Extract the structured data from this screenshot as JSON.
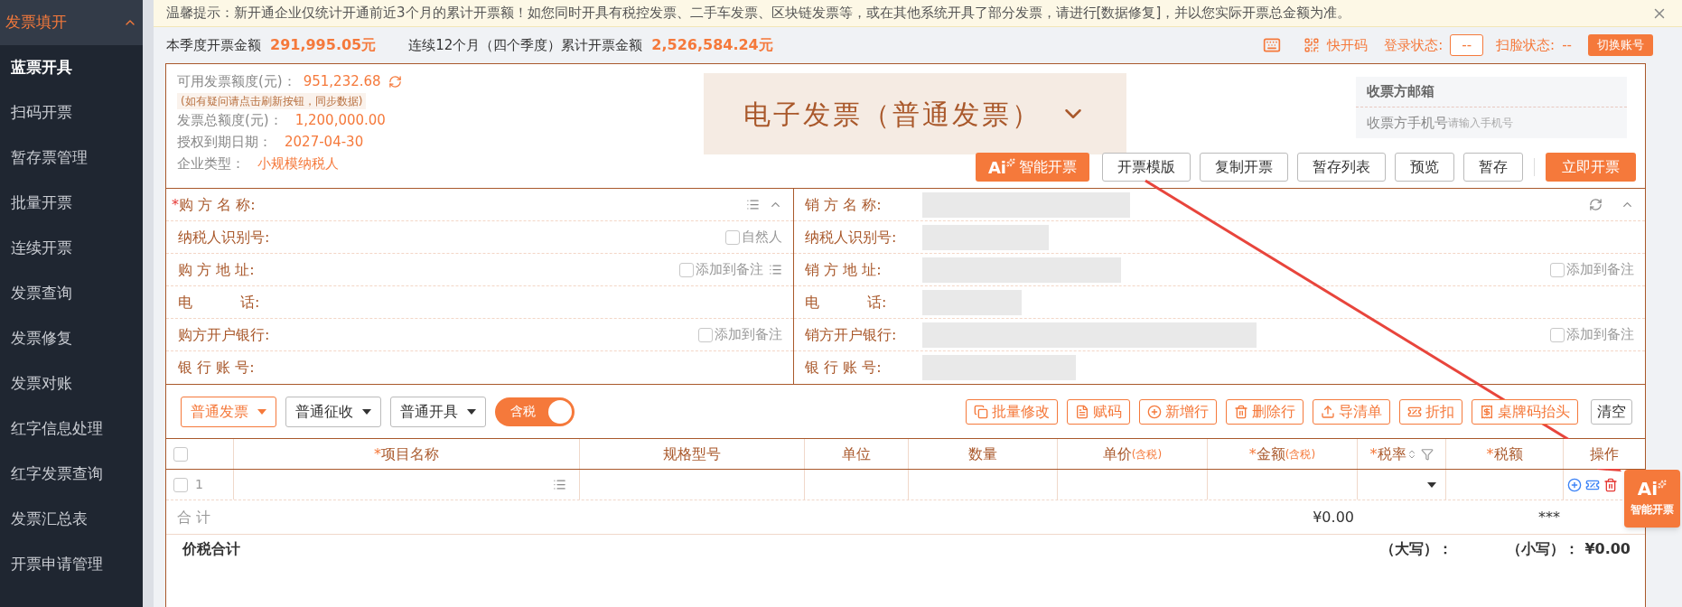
{
  "sidebar": {
    "title": "发票填开",
    "expanded": true,
    "items": [
      {
        "label": "蓝票开具",
        "selected": true
      },
      {
        "label": "扫码开票",
        "selected": false
      },
      {
        "label": "暂存票管理",
        "selected": false
      },
      {
        "label": "批量开票",
        "selected": false
      },
      {
        "label": "连续开票",
        "selected": false
      },
      {
        "label": "发票查询",
        "selected": false
      },
      {
        "label": "发票修复",
        "selected": false
      },
      {
        "label": "发票对账",
        "selected": false
      },
      {
        "label": "红字信息处理",
        "selected": false
      },
      {
        "label": "红字发票查询",
        "selected": false
      },
      {
        "label": "发票汇总表",
        "selected": false
      },
      {
        "label": "开票申请管理",
        "selected": false
      }
    ]
  },
  "notice": "温馨提示：新开通企业仅统计开通前近3个月的累计开票额！如您同时开具有税控发票、二手车发票、区块链发票等，或在其他系统开具了部分发票，请进行[数据修复]，并以您实际开票总金额为准。",
  "summary": {
    "quarter_label": "本季度开票金额",
    "quarter_value": "291,995.05元",
    "year_label": "连续12个月（四个季度）累计开票金额",
    "year_value": "2,526,584.24元"
  },
  "status": {
    "quick_code": "快开码",
    "login_label": "登录状态:",
    "login_value": "--",
    "face_label": "扫脸状态:",
    "face_value": "--",
    "switch_button": "切换账号"
  },
  "info": {
    "quota_label": "可用发票额度(元)：",
    "quota_value": "951,232.68",
    "hint": "(如有疑问请点击刷新按钮，同步数据)",
    "rows": [
      {
        "label": "发票总额度(元)：",
        "value": "1,200,000.00"
      },
      {
        "label": "授权到期日期：",
        "value": "2027-04-30"
      },
      {
        "label": "企业类型：",
        "value": "小规模纳税人"
      }
    ]
  },
  "invoice_type": "电子发票（普通发票）",
  "recipient": {
    "email_label": "收票方邮箱",
    "phone_label": "收票方手机号",
    "phone_placeholder": "请输入手机号"
  },
  "actions": [
    {
      "label": "智能开票",
      "kind": "ai",
      "glyph": "Ai"
    },
    {
      "label": "开票模版",
      "kind": "plain"
    },
    {
      "label": "复制开票",
      "kind": "plain"
    },
    {
      "label": "暂存列表",
      "kind": "plain"
    },
    {
      "label": "预览",
      "kind": "plain"
    },
    {
      "label": "暂存",
      "kind": "plain"
    },
    {
      "label": "立即开票",
      "kind": "primary"
    }
  ],
  "buyer": {
    "rows": [
      {
        "label": "购 方 名 称:",
        "mark": "*"
      },
      {
        "label": "纳税人识别号:",
        "checkbox": {
          "label": "自然人",
          "checked": false
        }
      },
      {
        "label": "购 方 地 址:",
        "checkbox": {
          "label": "添加到备注",
          "checked": false
        }
      },
      {
        "label": "电　　　 话:"
      },
      {
        "label": "购方开户银行:",
        "checkbox": {
          "label": "添加到备注",
          "checked": false
        }
      },
      {
        "label": "银 行 账 号:"
      }
    ]
  },
  "seller": {
    "blurred": true,
    "rows": [
      {
        "label": "销 方 名 称:"
      },
      {
        "label": "纳税人识别号:"
      },
      {
        "label": "销 方 地 址:",
        "checkbox": {
          "label": "添加到备注",
          "checked": false
        }
      },
      {
        "label": "电　　　 话:"
      },
      {
        "label": "销方开户银行:",
        "checkbox": {
          "label": "添加到备注",
          "checked": false
        }
      },
      {
        "label": "银 行 账 号:"
      }
    ]
  },
  "selectors": [
    {
      "label": "普通发票",
      "kind": "accent"
    },
    {
      "label": "普通征收",
      "kind": "plain"
    },
    {
      "label": "普通开具",
      "kind": "plain"
    }
  ],
  "tax_toggle": {
    "label": "含税",
    "on": true
  },
  "tools": [
    {
      "label": "批量修改",
      "kind": "accent"
    },
    {
      "label": "赋码",
      "kind": "accent"
    },
    {
      "label": "新增行",
      "kind": "accent"
    },
    {
      "label": "删除行",
      "kind": "accent"
    },
    {
      "label": "导清单",
      "kind": "accent"
    },
    {
      "label": "折扣",
      "kind": "accent"
    },
    {
      "label": "桌牌码抬头",
      "kind": "accent"
    },
    {
      "label": "清空",
      "kind": "plain"
    }
  ],
  "table": {
    "all_checked": false,
    "columns": [
      {
        "label": "项目名称",
        "mark": "*"
      },
      {
        "label": "规格型号"
      },
      {
        "label": "单位"
      },
      {
        "label": "数量"
      },
      {
        "label": "单价",
        "note": "(含税)"
      },
      {
        "label": "金额",
        "mark": "*",
        "note": "(含税)"
      },
      {
        "label": "税率",
        "mark": "*"
      },
      {
        "label": "税额",
        "mark": "*"
      },
      {
        "label": "操作"
      }
    ],
    "rows": [
      {
        "number": "1",
        "checked": false
      }
    ],
    "total_label": "合 计",
    "total_amount": "¥0.00",
    "total_tax": "***",
    "grand_label": "价税合计",
    "upper_label": "（大写）：",
    "lower_label": "（小写）：",
    "lower_value": "¥0.00"
  },
  "float_button": {
    "label": "智能开票",
    "glyph": "Ai"
  }
}
